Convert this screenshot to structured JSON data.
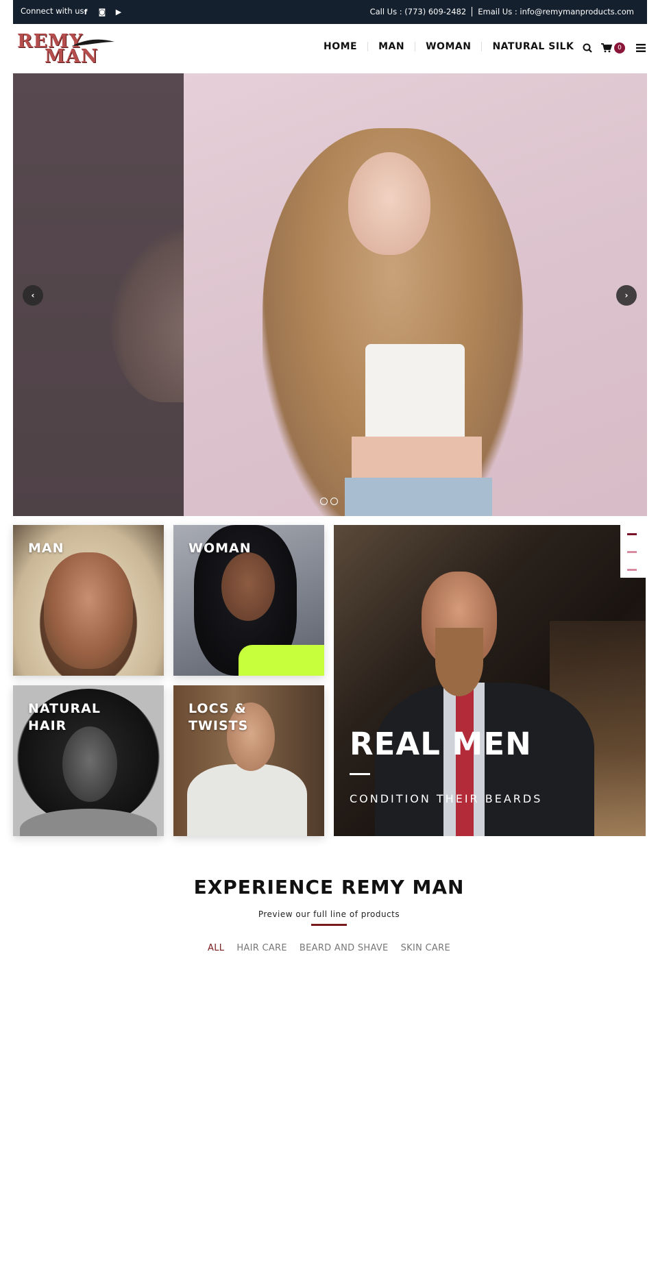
{
  "topbar": {
    "connect_label": "Connect with us",
    "social": [
      {
        "icon": "facebook-icon",
        "glyph": "f"
      },
      {
        "icon": "instagram-icon",
        "glyph": "◙"
      },
      {
        "icon": "youtube-icon",
        "glyph": "▶"
      }
    ],
    "call": "Call Us : (773) 609-2482",
    "email": "Email Us : info@remymanproducts.com"
  },
  "header": {
    "logo_line1": "REMY",
    "logo_line2": "MAN",
    "nav": [
      "HOME",
      "MAN",
      "WOMAN",
      "NATURAL SILK"
    ],
    "cart_count": "0"
  },
  "hero": {
    "prev_glyph": "‹",
    "next_glyph": "›",
    "slide_count": 2
  },
  "categories": [
    {
      "label": "MAN"
    },
    {
      "label": "WOMAN"
    },
    {
      "label": "NATURAL\nHAIR"
    },
    {
      "label": "LOCS &\nTWISTS"
    }
  ],
  "feature": {
    "title": "REAL MEN",
    "subtitle": "CONDITION THEIR BEARDS"
  },
  "section": {
    "title": "EXPERIENCE REMY MAN",
    "subtitle": "Preview our full line of products",
    "filters": [
      "ALL",
      "HAIR CARE",
      "BEARD AND SHAVE",
      "SKIN CARE"
    ],
    "active_filter": "ALL"
  },
  "colors": {
    "topbar_bg": "#14202e",
    "accent": "#8a1538",
    "rule": "#7a1a1a"
  }
}
